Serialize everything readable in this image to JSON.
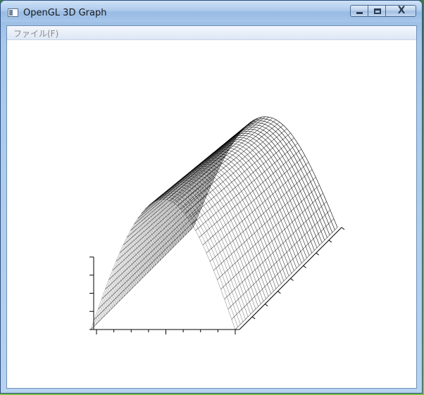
{
  "window": {
    "title": "OpenGL 3D Graph",
    "icon": "app-window-icon",
    "buttons": {
      "minimize_icon": "minimize-icon",
      "maximize_icon": "maximize-icon",
      "close_glyph": "X"
    }
  },
  "menubar": {
    "items": [
      {
        "label": "ファイル(F)"
      }
    ]
  },
  "graph": {
    "surface_color": "#000000",
    "background_color": "#ffffff",
    "axes_color": "#000000"
  }
}
